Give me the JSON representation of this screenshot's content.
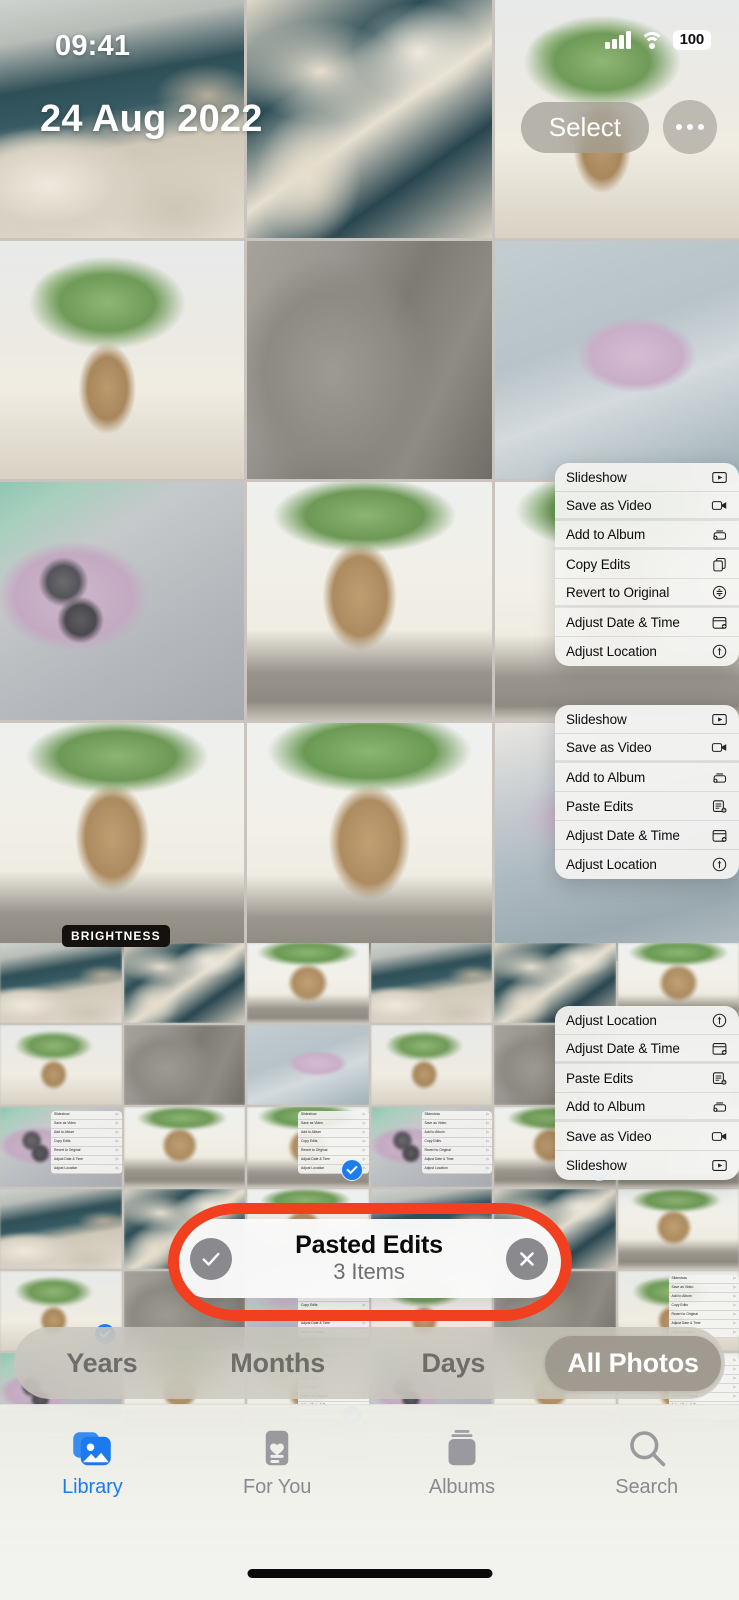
{
  "statusbar": {
    "time": "09:41",
    "battery": "100",
    "signal_icon": "cellular-bars-icon",
    "wifi_icon": "wifi-icon",
    "battery_icon": "battery-badge"
  },
  "header": {
    "date": "24 Aug 2022",
    "select_label": "Select",
    "more_icon": "ellipsis-icon"
  },
  "badges": {
    "brightness": "BRIGHTNESS"
  },
  "context_menus": {
    "copy_menu": {
      "items": [
        {
          "label": "Slideshow",
          "icon": "slideshow-icon",
          "separator": false
        },
        {
          "label": "Save as Video",
          "icon": "video-icon",
          "separator": true
        },
        {
          "label": "Add to Album",
          "icon": "add-to-album-icon",
          "separator": true
        },
        {
          "label": "Copy Edits",
          "icon": "copy-edits-icon",
          "separator": false
        },
        {
          "label": "Revert to Original",
          "icon": "revert-icon",
          "separator": true
        },
        {
          "label": "Adjust Date & Time",
          "icon": "calendar-icon",
          "separator": false
        },
        {
          "label": "Adjust Location",
          "icon": "location-icon",
          "separator": false
        }
      ]
    },
    "paste_menu": {
      "items": [
        {
          "label": "Slideshow",
          "icon": "slideshow-icon",
          "separator": false
        },
        {
          "label": "Save as Video",
          "icon": "video-icon",
          "separator": true
        },
        {
          "label": "Add to Album",
          "icon": "add-to-album-icon",
          "separator": false
        },
        {
          "label": "Paste Edits",
          "icon": "paste-edits-icon",
          "separator": false
        },
        {
          "label": "Adjust Date & Time",
          "icon": "calendar-icon",
          "separator": false
        },
        {
          "label": "Adjust Location",
          "icon": "location-icon",
          "separator": false
        }
      ]
    },
    "reversed_menu": {
      "items": [
        {
          "label": "Adjust Location",
          "icon": "location-icon",
          "separator": false
        },
        {
          "label": "Adjust Date & Time",
          "icon": "calendar-icon",
          "separator": true
        },
        {
          "label": "Paste Edits",
          "icon": "paste-edits-icon",
          "separator": false
        },
        {
          "label": "Add to Album",
          "icon": "add-to-album-icon",
          "separator": true
        },
        {
          "label": "Save as Video",
          "icon": "video-icon",
          "separator": false
        },
        {
          "label": "Slideshow",
          "icon": "slideshow-icon",
          "separator": false
        }
      ]
    }
  },
  "toast": {
    "title": "Pasted Edits",
    "subtitle": "3 Items",
    "confirm_icon": "checkmark-icon",
    "dismiss_icon": "close-icon"
  },
  "annotation": {
    "shape": "ellipse-highlight",
    "color": "#f0401f"
  },
  "segmented": {
    "options": [
      "Years",
      "Months",
      "Days",
      "All Photos"
    ],
    "selected": "All Photos"
  },
  "tabbar": {
    "tabs": [
      {
        "label": "Library",
        "icon": "photo-stack-icon",
        "active": true
      },
      {
        "label": "For You",
        "icon": "heart-card-icon",
        "active": false
      },
      {
        "label": "Albums",
        "icon": "albums-icon",
        "active": false
      },
      {
        "label": "Search",
        "icon": "search-icon",
        "active": false
      }
    ]
  },
  "grid": {
    "big_cells": [
      "ph-patio",
      "ph-chairs",
      "ph-plantpot",
      "ph-plantpot",
      "ph-bag",
      "ph-phone",
      "ph-phoneclose",
      "ph-plantwood",
      "ph-plantwood2",
      "ph-plantwood",
      "ph-plantwood2",
      "ph-phonebed"
    ],
    "small_cells": [
      "ph-patio",
      "ph-chairs",
      "ph-plantwood2",
      "ph-patio",
      "ph-chairs",
      "ph-plantwood2",
      "ph-plantpot",
      "ph-bag",
      "ph-phone",
      "ph-plantpot",
      "ph-bag",
      "ph-phone",
      "ph-phoneclose",
      "ph-plantwood",
      "ph-plantwood2",
      "ph-phoneclose",
      "ph-plantwood",
      "ph-plantwood2",
      "ph-patio",
      "ph-chairs",
      "ph-plantwood",
      "ph-patio",
      "ph-chairs",
      "ph-plantwood",
      "ph-plantpot",
      "ph-bag",
      "ph-phonebed",
      "ph-plantpot",
      "ph-bag",
      "ph-plantpot",
      "ph-phoneclose",
      "ph-plantwood",
      "ph-plantwood2",
      "ph-phoneclose",
      "ph-plantwood",
      "ph-plantwood2"
    ]
  }
}
